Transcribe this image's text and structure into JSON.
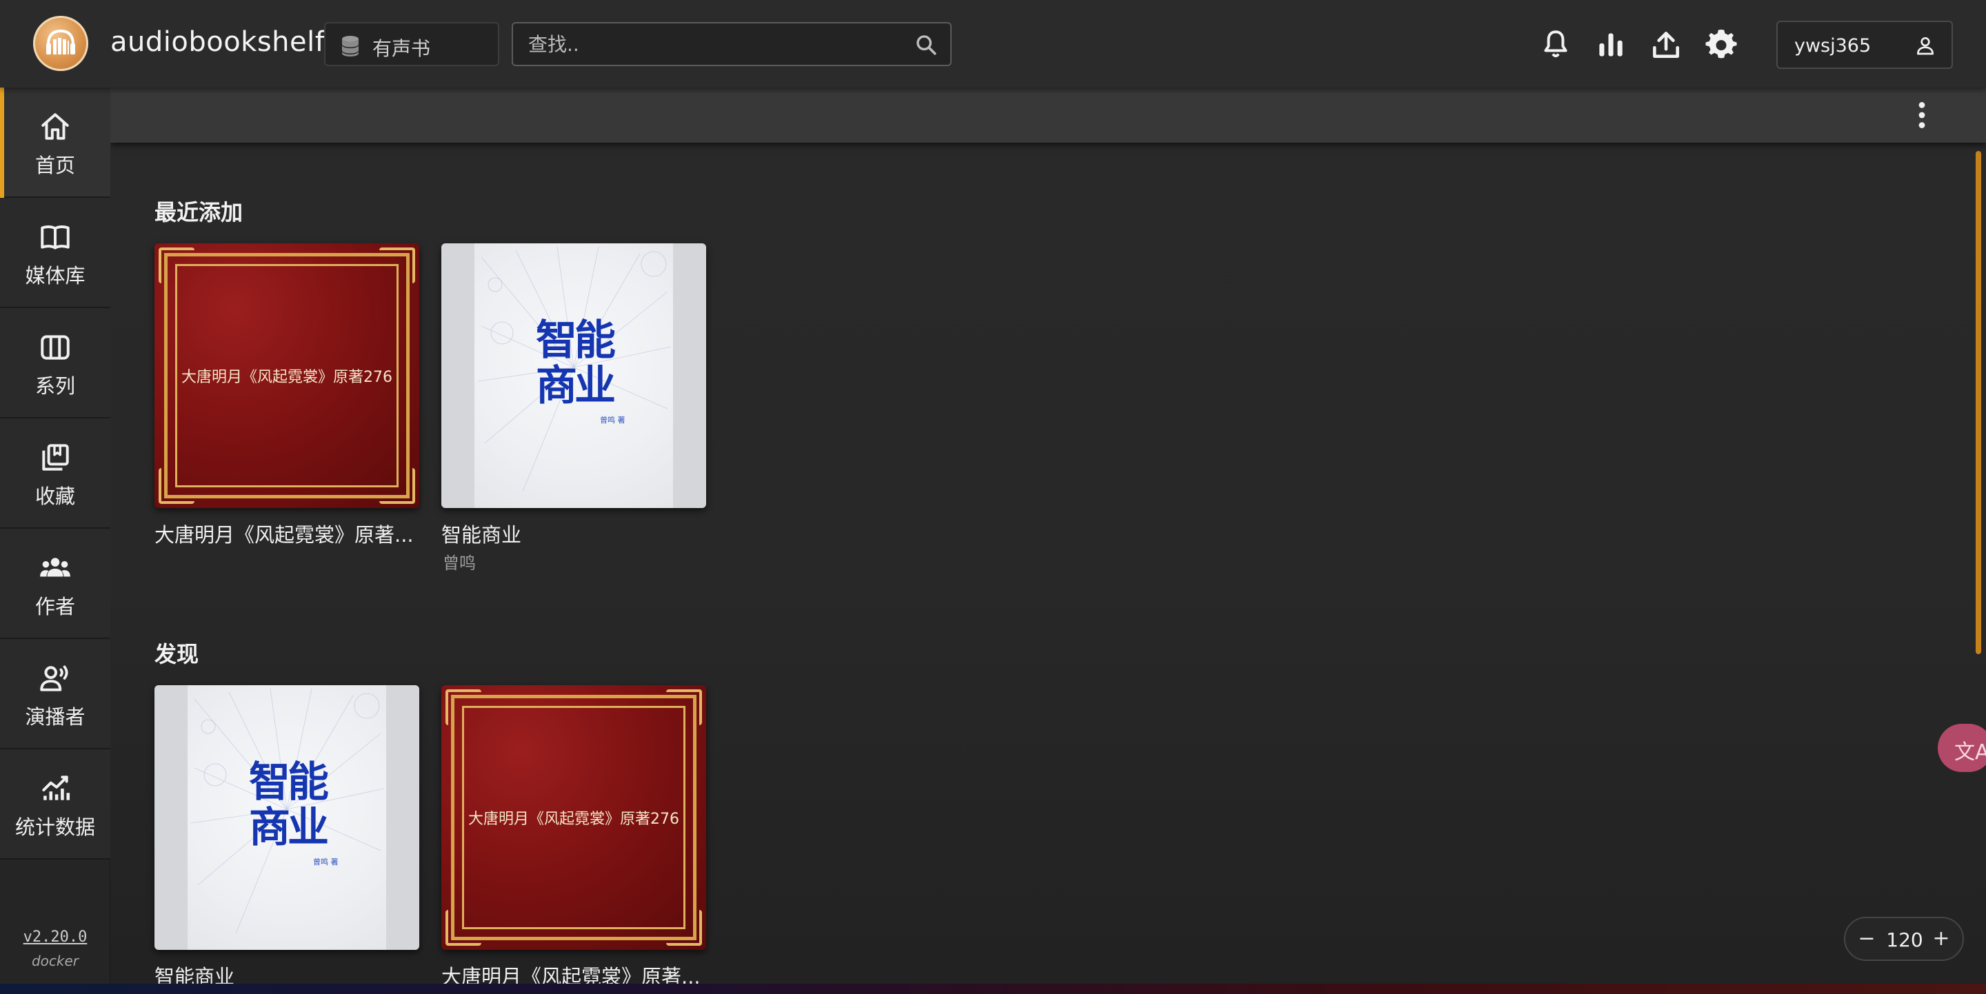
{
  "app": {
    "title": "audiobookshelf"
  },
  "header": {
    "library_label": "有声书",
    "search_placeholder": "查找..",
    "username": "ywsj365",
    "icons": [
      "bell-icon",
      "stats-icon",
      "upload-icon",
      "settings-icon",
      "user-icon"
    ]
  },
  "sidebar": {
    "items": [
      {
        "label": "首页",
        "icon": "home-icon",
        "active": true
      },
      {
        "label": "媒体库",
        "icon": "book-open-icon",
        "active": false
      },
      {
        "label": "系列",
        "icon": "columns-icon",
        "active": false
      },
      {
        "label": "收藏",
        "icon": "collection-icon",
        "active": false
      },
      {
        "label": "作者",
        "icon": "people-icon",
        "active": false
      },
      {
        "label": "演播者",
        "icon": "narrator-icon",
        "active": false
      },
      {
        "label": "统计数据",
        "icon": "chart-icon",
        "active": false
      }
    ],
    "version": "v2.20.0",
    "platform": "docker"
  },
  "shelves": [
    {
      "title": "最近添加",
      "books": [
        {
          "title": "大唐明月《风起霓裳》原著...",
          "cover_text": "大唐明月《风起霓裳》原著276",
          "author": ""
        },
        {
          "title": "智能商业",
          "author": "曾鸣",
          "cover_title": "智能商业",
          "cover_author": "曾鸣 著"
        }
      ]
    },
    {
      "title": "发现",
      "books": [
        {
          "title": "智能商业",
          "author": "",
          "cover_title": "智能商业",
          "cover_author": "曾鸣 著"
        },
        {
          "title": "大唐明月《风起霓裳》原著...",
          "cover_text": "大唐明月《风起霓裳》原著276",
          "author": ""
        }
      ]
    }
  ],
  "zoom": {
    "minus": "−",
    "value": "120",
    "plus": "+"
  },
  "translate_button": {
    "label": "文A"
  },
  "colors": {
    "accent": "#e6a020",
    "topbar": "#2b2b2b",
    "sidebar": "#252525",
    "content_bg": "#282828"
  }
}
